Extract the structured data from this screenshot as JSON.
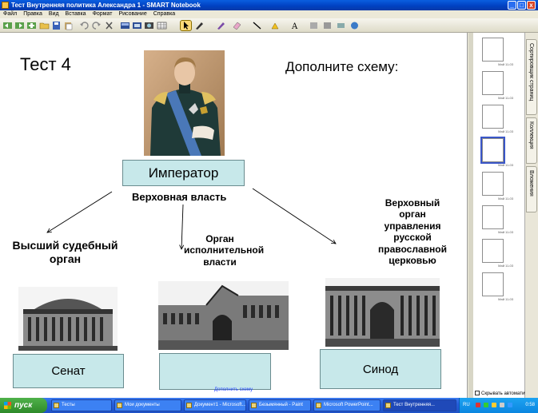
{
  "window": {
    "title": "Тест Внутренняя политика Александра 1 - SMART Notebook",
    "buttons": [
      "_",
      "□",
      "x"
    ]
  },
  "menu": [
    "Файл",
    "Правка",
    "Вид",
    "Вставка",
    "Формат",
    "Рисование",
    "Справка"
  ],
  "slide": {
    "title": "Тест 4",
    "instruction": "Дополните схему:",
    "emperor_box": "Император",
    "supreme_power": "Верховная власть",
    "court_label": "Высший судебный орган",
    "exec_label": "Орган исполнительной власти",
    "church_label": "Верховный орган управления русской православной церковью",
    "senate_box": "Сенат",
    "empty_box": "",
    "synod_box": "Синод",
    "hyperlink": "Дополнить схему"
  },
  "side_panel": {
    "tabs": [
      "Сортировщик страниц",
      "Коллекция",
      "Вложения"
    ],
    "autohide": "Скрывать автоматически",
    "thumbs": [
      "Май 11-03",
      "Май 11-03",
      "Май 11-03",
      "Май 11-03",
      "Май 11-03",
      "Май 11-03",
      "Май 11-03",
      "Май 11-03"
    ]
  },
  "taskbar": {
    "start": "пуск",
    "items": [
      "Тесты",
      "Мои документы",
      "Документ1 - Microsoft...",
      "Безымянный - Paint",
      "Microsoft PowerPoint...",
      "Тест Внутренняя..."
    ],
    "lang": "RU",
    "clock": "0:58"
  },
  "colors": {
    "box_fill": "#c7e8ea",
    "titlebar": "#0a5fe0",
    "taskbar": "#245edb",
    "start": "#3a9a36"
  }
}
